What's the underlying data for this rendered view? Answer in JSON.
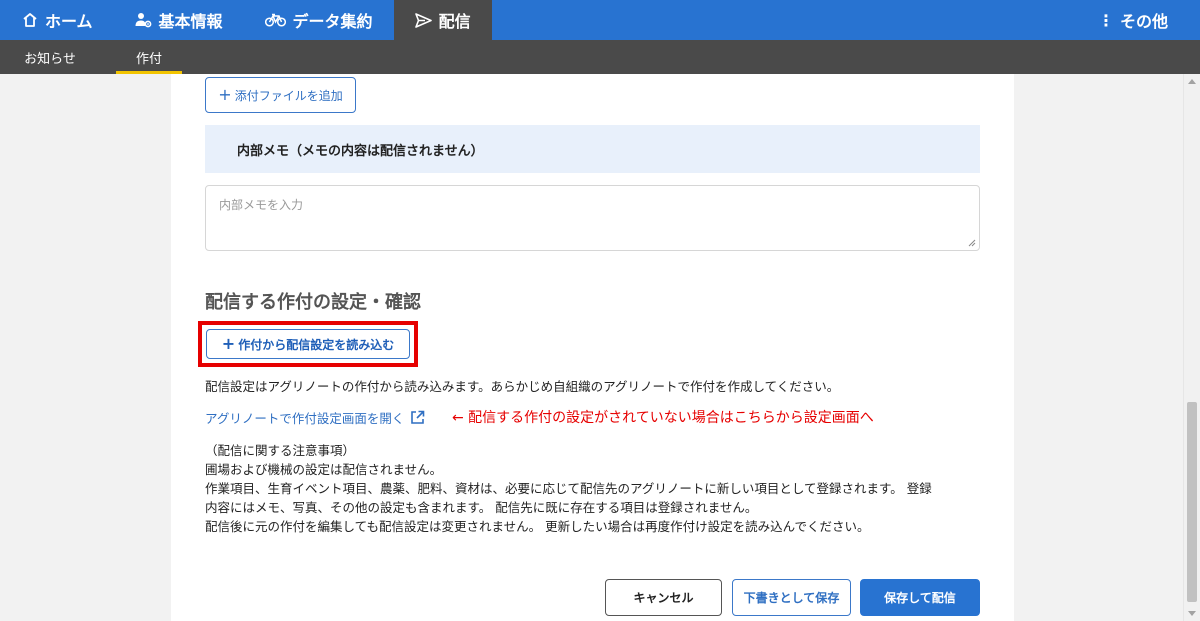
{
  "nav": {
    "items": [
      {
        "label": "ホーム",
        "icon": "home-icon"
      },
      {
        "label": "基本情報",
        "icon": "people-gear-icon"
      },
      {
        "label": "データ集約",
        "icon": "bicycle-icon"
      },
      {
        "label": "配信",
        "icon": "send-icon"
      }
    ],
    "more_label": "その他",
    "active": "配信"
  },
  "subnav": {
    "items": [
      {
        "label": "お知らせ"
      },
      {
        "label": "作付"
      }
    ],
    "active": "作付"
  },
  "attach_button": "添付ファイルを追加",
  "memo": {
    "header": "内部メモ（メモの内容は配信されません）",
    "placeholder": "内部メモを入力"
  },
  "section_title": "配信する作付の設定・確認",
  "load_button": "作付から配信設定を読み込む",
  "description": "配信設定はアグリノートの作付から読み込みます。あらかじめ自組織のアグリノートで作付を作成してください。",
  "open_link": "アグリノートで作付設定画面を開く",
  "annotation": "← 配信する作付の設定がされていない場合はこちらから設定画面へ",
  "notes": [
    "（配信に関する注意事項）",
    "圃場および機械の設定は配信されません。",
    "作業項目、生育イベント項目、農薬、肥料、資材は、必要に応じて配信先のアグリノートに新しい項目として登録されます。 登録",
    "内容にはメモ、写真、その他の設定も含まれます。 配信先に既に存在する項目は登録されません。",
    "配信後に元の作付を編集しても配信設定は変更されません。 更新したい場合は再度作付け設定を読み込んでください。"
  ],
  "buttons": {
    "cancel": "キャンセル",
    "draft": "下書きとして保存",
    "send": "保存して配信"
  },
  "colors": {
    "primary": "#2873d1",
    "nav_active": "#4a4a4a",
    "highlight": "#e60000",
    "tab_indicator": "#f2c400"
  }
}
